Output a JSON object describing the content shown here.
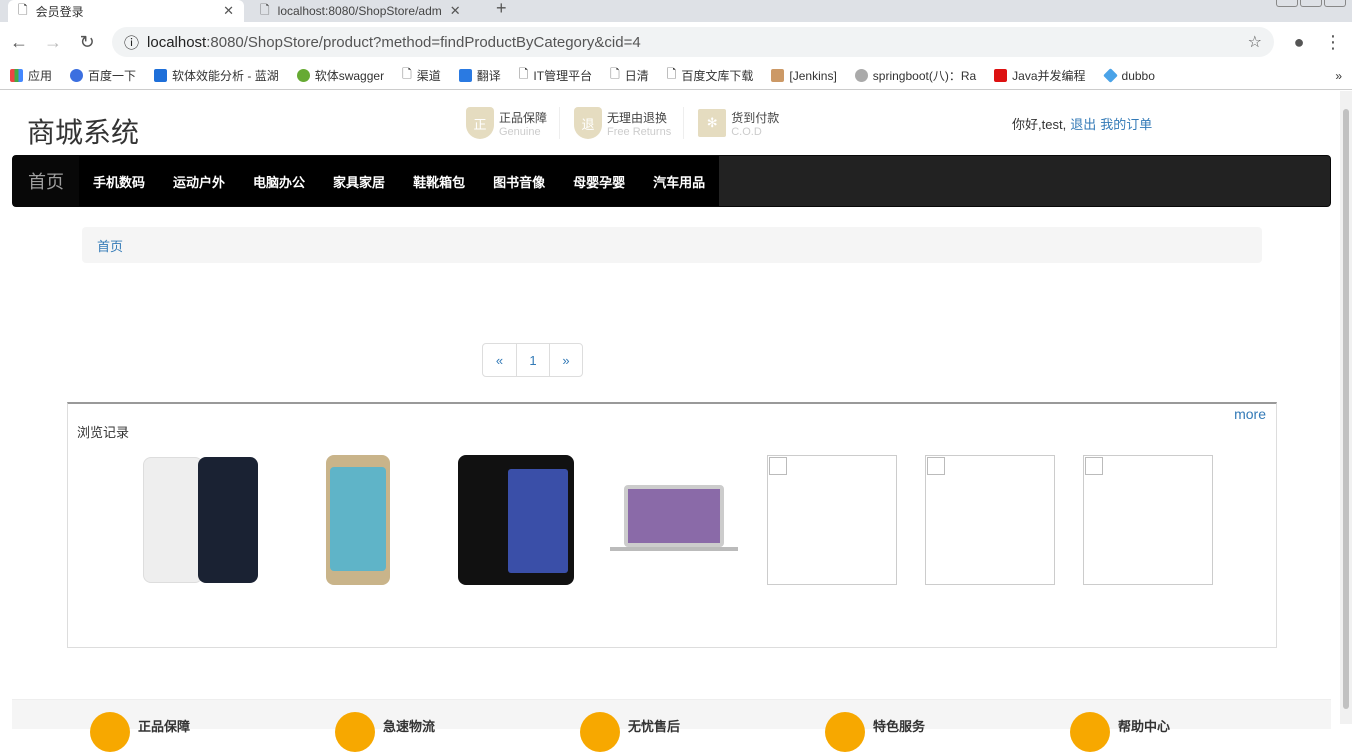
{
  "browser": {
    "tabs": [
      {
        "title": "会员登录"
      },
      {
        "title": "localhost:8080/ShopStore/adm"
      }
    ],
    "url_host": "localhost",
    "url_rest": ":8080/ShopStore/product?method=findProductByCategory&cid=4",
    "bookmarks": [
      "应用",
      "百度一下",
      "软体效能分析 - 蓝湖",
      "软体swagger",
      "渠道",
      "翻译",
      "IT管理平台",
      "日清",
      "百度文库下载",
      "[Jenkins]",
      "springboot(八)：Ra",
      "Java并发编程",
      "dubbo"
    ]
  },
  "header": {
    "logo": "商城系统",
    "badges": [
      {
        "icon": "正",
        "title": "正品保障",
        "sub": "Genuine"
      },
      {
        "icon": "退",
        "title": "无理由退换",
        "sub": "Free Returns"
      },
      {
        "icon": "✻",
        "title": "货到付款",
        "sub": "C.O.D"
      }
    ],
    "greeting": "你好,test,",
    "logout": "退出",
    "orders": "我的订单"
  },
  "menu": {
    "home": "首页",
    "items": [
      "手机数码",
      "运动户外",
      "电脑办公",
      "家具家居",
      "鞋靴箱包",
      "图书音像",
      "母婴孕婴",
      "汽车用品"
    ]
  },
  "breadcrumb": "首页",
  "pager": {
    "prev": "«",
    "current": "1",
    "next": "»"
  },
  "history": {
    "title": "浏览记录",
    "more": "more"
  },
  "footer": {
    "items": [
      "正品保障",
      "急速物流",
      "无忧售后",
      "特色服务",
      "帮助中心"
    ]
  }
}
